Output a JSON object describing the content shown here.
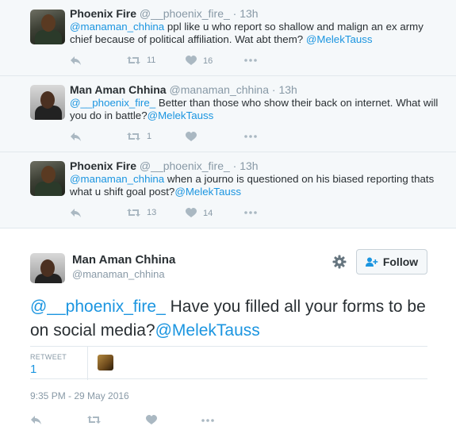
{
  "replies": [
    {
      "name": "Phoenix Fire",
      "handle": "@__phoenix_fire_",
      "time": "13h",
      "text_mention": "@manaman_chhina",
      "text_body": " ppl like u who report so shallow and malign an ex army chief because of political affiliation. Wat abt them? ",
      "text_tag": "@MelekTauss",
      "retweets": "11",
      "likes": "16"
    },
    {
      "name": "Man Aman Chhina",
      "handle": "@manaman_chhina",
      "time": "13h",
      "text_mention": "@__phoenix_fire_",
      "text_body": " Better than those who show their back on internet. What will you do in battle?",
      "text_tag": "@MelekTauss",
      "retweets": "1",
      "likes": ""
    },
    {
      "name": "Phoenix Fire",
      "handle": "@__phoenix_fire_",
      "time": "13h",
      "text_mention": "@manaman_chhina",
      "text_body": " when a journo is questioned on his biased reporting thats what u  shift goal post?",
      "text_tag": "@MelekTauss",
      "retweets": "13",
      "likes": "14"
    }
  ],
  "main_tweet": {
    "name": "Man Aman Chhina",
    "handle": "@manaman_chhina",
    "follow_label": "Follow",
    "text_mention": "@__phoenix_fire_",
    "text_body": " Have you filled all your forms to be on social media?",
    "text_tag": "@MelekTauss",
    "retweet_label": "RETWEET",
    "retweet_count": "1",
    "timestamp": "9:35 PM - 29 May 2016"
  },
  "colors": {
    "link": "#1b95e0",
    "reply_bg": "#f5f8fa",
    "meta_gray": "#8899a6",
    "icon_gray": "#aab8c2"
  },
  "icons": [
    "reply-icon",
    "retweet-icon",
    "like-icon",
    "more-icon",
    "gear-icon",
    "follow-user-icon"
  ]
}
